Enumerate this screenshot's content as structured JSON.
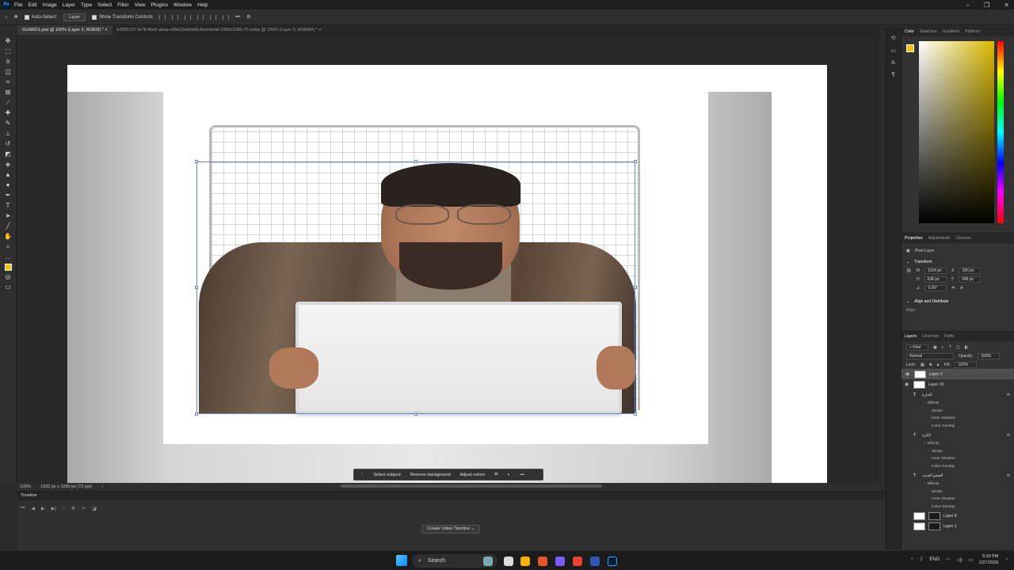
{
  "app": {
    "logo": "Ps",
    "menu": [
      "File",
      "Edit",
      "Image",
      "Layer",
      "Type",
      "Select",
      "Filter",
      "View",
      "Plugins",
      "Window",
      "Help"
    ]
  },
  "options_bar": {
    "auto_select_label": "Auto-Select:",
    "auto_select_value": "Layer",
    "show_transform_label": "Show Transform Controls"
  },
  "doc_tabs": [
    {
      "label": "GUARD1.psd @ 100% (Layer 2, RGB/8) *",
      "active": true
    },
    {
      "label": "b3555107-fe78-4bd1-a6ea-c8bd10ab5e6b-thumbnail-1080x1080-70.webp @ 100% (Layer 0, RGB/8#) *",
      "active": false
    }
  ],
  "contextual_taskbar": {
    "select_subject": "Select subject",
    "remove_background": "Remove background",
    "adjust_colors": "Adjust colors"
  },
  "status": {
    "zoom": "100%",
    "doc_size": "1920 px x 1080 px (72 ppi)"
  },
  "timeline": {
    "title": "Timeline",
    "create_button": "Create Video Timeline"
  },
  "color_panel": {
    "tabs": [
      "Color",
      "Swatches",
      "Gradients",
      "Patterns"
    ],
    "foreground": "#f4c20d"
  },
  "properties": {
    "tabs": [
      "Properties",
      "Adjustments",
      "Libraries"
    ],
    "layer_kind": "Pixel Layer",
    "section_transform": "Transform",
    "w_label": "W",
    "w_value": "1104 px",
    "h_label": "H",
    "h_value": "638 px",
    "x_label": "X",
    "x_value": "330 px",
    "y_label": "Y",
    "y_value": "246 px",
    "angle_value": "0.00°",
    "section_align": "Align and Distribute",
    "align_label": "Align:"
  },
  "layers": {
    "tabs": [
      "Layers",
      "Channels",
      "Paths"
    ],
    "filter_kind": "Kind",
    "blend_mode": "Normal",
    "opacity_label": "Opacity:",
    "opacity_value": "100%",
    "lock_label": "Lock:",
    "fill_label": "Fill:",
    "fill_value": "100%",
    "items": [
      {
        "name": "Layer 2",
        "selected": true,
        "visible": true
      },
      {
        "name": "Layer 10",
        "selected": false,
        "visible": true
      }
    ],
    "text_groups": [
      {
        "name": "الحارة",
        "fx": "fx",
        "effects_label": "Effects",
        "effects": [
          "Stroke",
          "Inner Shadow",
          "Color Overlay"
        ]
      },
      {
        "name": "الكرة",
        "fx": "fx",
        "effects_label": "Effects",
        "effects": [
          "Stroke",
          "Inner Shadow",
          "Color Overlay"
        ]
      },
      {
        "name": "العضو الجديد",
        "fx": "fx",
        "effects_label": "Effects",
        "effects": [
          "Stroke",
          "Inner Shadow",
          "Color Overlay"
        ]
      }
    ],
    "bottom_layers": [
      "Layer 8",
      "Layer 1"
    ]
  },
  "taskbar": {
    "search_placeholder": "Search",
    "language": "ENG",
    "time": "9:19 PM",
    "date": "2/27/2026"
  }
}
